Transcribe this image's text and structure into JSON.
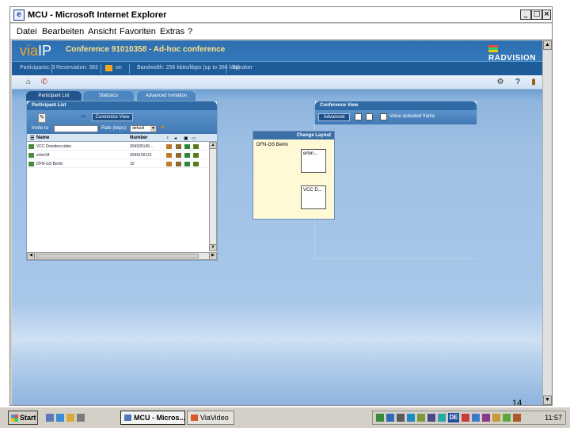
{
  "window": {
    "title": "MCU - Microsoft Internet Explorer",
    "buttons": {
      "minimize": "_",
      "maximize": "□",
      "close": "×"
    }
  },
  "menu": [
    "Datei",
    "Bearbeiten",
    "Ansicht",
    "Favoriten",
    "Extras",
    "?"
  ],
  "app": {
    "logo_via": "via",
    "logo_ip": "IP",
    "conference_title": "Conference 91010358 - Ad-hoc conference",
    "brand": "RADVISION",
    "status": {
      "participants": "Participants: 3",
      "reservation": "Reservation: 383",
      "lock": "on",
      "bandwidth": "Bandwidth: 256 kbits/kbps (up to 384 kbit)",
      "speaker": "Speaker"
    }
  },
  "tabs": [
    "Participant List",
    "Statistics",
    "Advanced Invitation"
  ],
  "participant_panel": {
    "header": "Participant List",
    "customize_button": "Customize View",
    "invite_label": "Invite to",
    "rate_label": "Rate (kbps):",
    "rate_value": "default",
    "columns": {
      "name": "Name",
      "number": "Number"
    },
    "rows": [
      {
        "name": "VCC Dresden:video",
        "number": "004935145..."
      },
      {
        "name": "erlon34",
        "number": "0049100121"
      },
      {
        "name": "DFN-GS Berlin",
        "number": "10"
      }
    ]
  },
  "conference_panel": {
    "header": "Conference View",
    "advanced_button": "Advanced",
    "frame_label": "Voice activated frame"
  },
  "layout_popup": {
    "header": "Change Layout",
    "selected": "DFN-GS Berlin",
    "frame1": "erlon...",
    "frame2": "VCC D..."
  },
  "page_number": "14",
  "taskbar": {
    "start": "Start",
    "tasks": [
      "MCU - Micros...",
      "ViaVideo"
    ],
    "lang": "DE",
    "clock": "11:57"
  },
  "colors": {
    "header_blue": "#2d6fb0",
    "accent_orange": "#f5a623",
    "title_yellow": "#ffe08a"
  }
}
